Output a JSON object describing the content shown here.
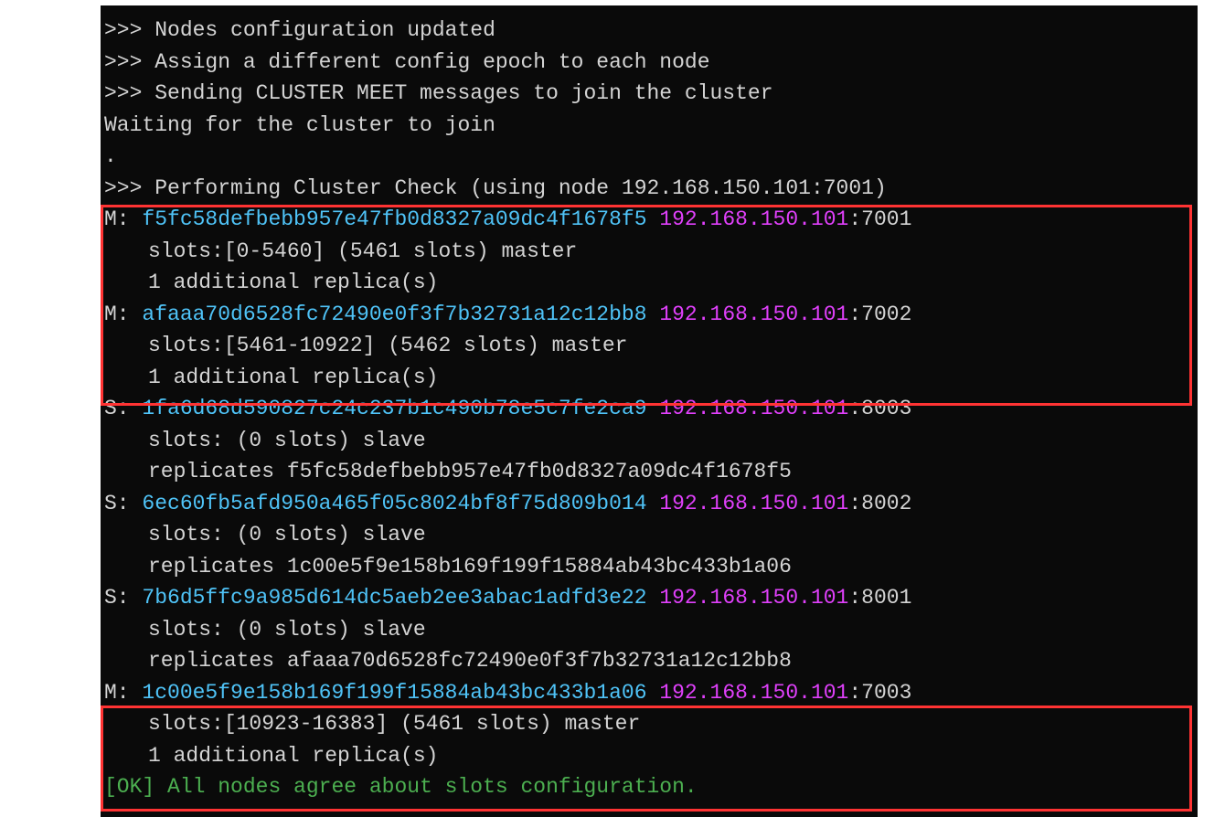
{
  "header": {
    "l1": ">>> Nodes configuration updated",
    "l2": ">>> Assign a different config epoch to each node",
    "l3": ">>> Sending CLUSTER MEET messages to join the cluster",
    "l4": "Waiting for the cluster to join",
    "l5": ".",
    "l6_prefix": ">>> Performing Cluster Check (using node ",
    "l6_ip": "192.168.150.101:7001",
    "l6_suffix": ")"
  },
  "nodes": [
    {
      "role": "M:",
      "hash": "f5fc58defbebb957e47fb0d8327a09dc4f1678f5",
      "ip": "192.168.150.101",
      "port": ":7001",
      "slots": "slots:[0-5460] (5461 slots) master",
      "extra": "1 additional replica(s)"
    },
    {
      "role": "M:",
      "hash": "afaaa70d6528fc72490e0f3f7b32731a12c12bb8",
      "ip": "192.168.150.101",
      "port": ":7002",
      "slots": "slots:[5461-10922] (5462 slots) master",
      "extra": "1 additional replica(s)"
    },
    {
      "role": "S:",
      "hash": "1fa6d68d590827c24c237b1c490b78e5c7fe2ca9",
      "ip": "192.168.150.101",
      "port": ":8003",
      "slots": "slots: (0 slots) slave",
      "extra": "replicates f5fc58defbebb957e47fb0d8327a09dc4f1678f5"
    },
    {
      "role": "S:",
      "hash": "6ec60fb5afd950a465f05c8024bf8f75d809b014",
      "ip": "192.168.150.101",
      "port": ":8002",
      "slots": "slots: (0 slots) slave",
      "extra": "replicates 1c00e5f9e158b169f199f15884ab43bc433b1a06"
    },
    {
      "role": "S:",
      "hash": "7b6d5ffc9a985d614dc5aeb2ee3abac1adfd3e22",
      "ip": "192.168.150.101",
      "port": ":8001",
      "slots": "slots: (0 slots) slave",
      "extra": "replicates afaaa70d6528fc72490e0f3f7b32731a12c12bb8"
    },
    {
      "role": "M:",
      "hash": "1c00e5f9e158b169f199f15884ab43bc433b1a06",
      "ip": "192.168.150.101",
      "port": ":7003",
      "slots": "slots:[10923-16383] (5461 slots) master",
      "extra": "1 additional replica(s)"
    }
  ],
  "footer": {
    "ok_prefix": "[OK]",
    "ok_text": " All nodes agree about slots configuration."
  }
}
